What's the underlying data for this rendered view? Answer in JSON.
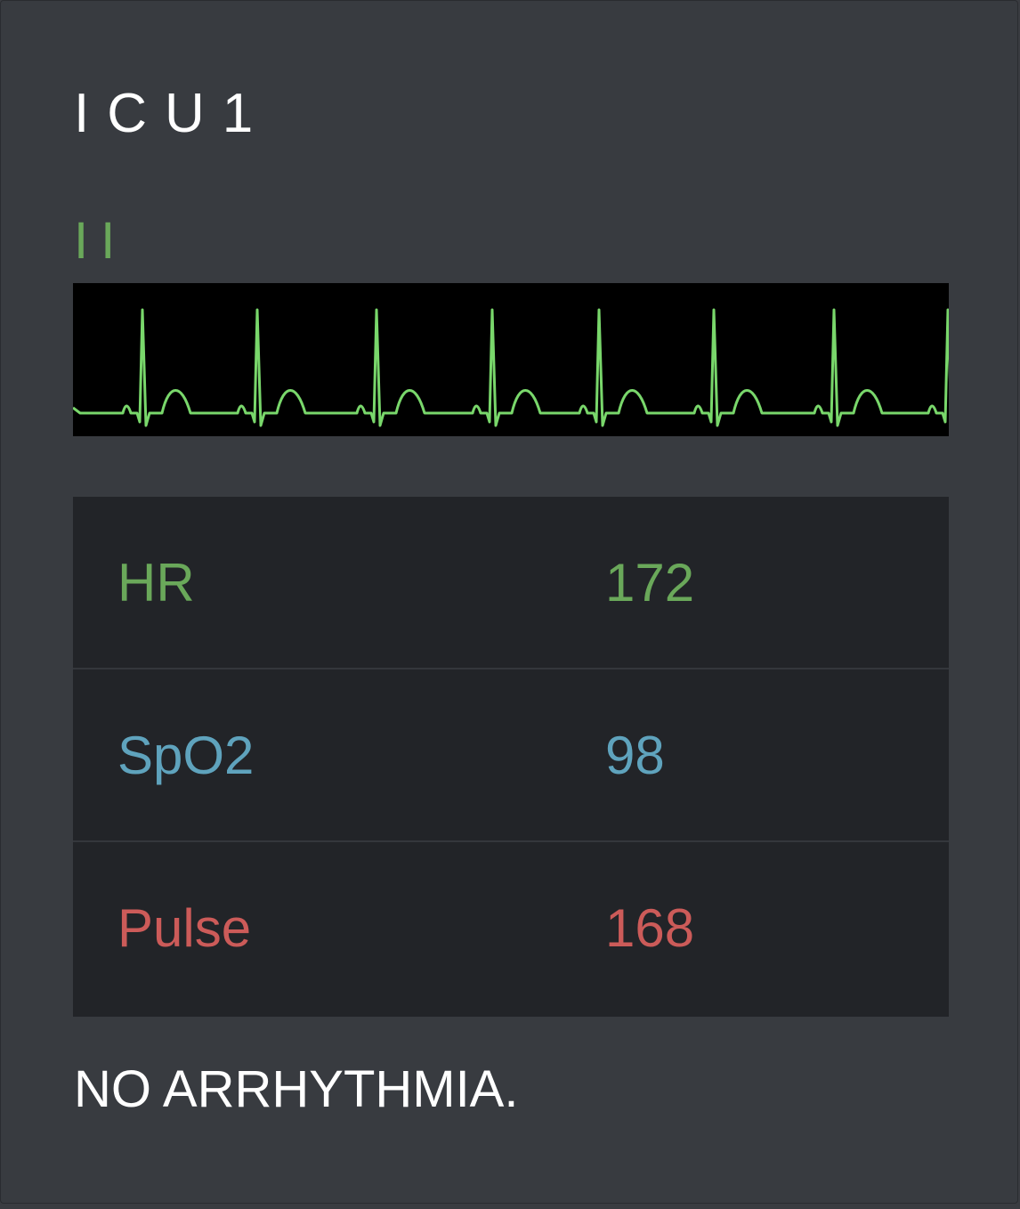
{
  "monitor": {
    "title": "ICU1",
    "lead_label": "II",
    "status": "NO ARRHYTHMIA."
  },
  "vitals": [
    {
      "label": "HR",
      "value": "172"
    },
    {
      "label": "SpO2",
      "value": "98"
    },
    {
      "label": "Pulse",
      "value": "168"
    }
  ],
  "colors": {
    "ecg_trace": "#79d76b",
    "lead_label": "#6aa85a",
    "hr": "#6aa85a",
    "spo2": "#5fa3bd",
    "pulse": "#cc5b59",
    "background": "#383b40"
  }
}
